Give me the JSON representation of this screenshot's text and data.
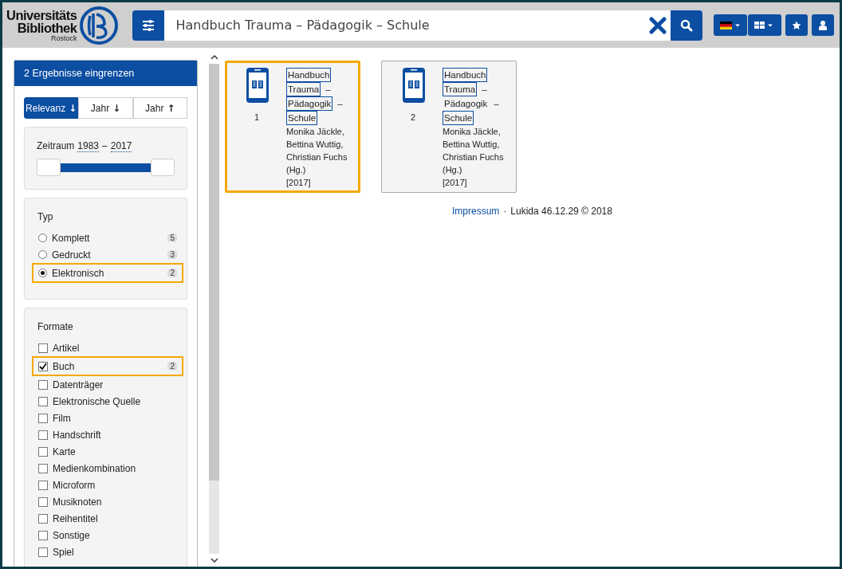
{
  "header": {
    "logo": {
      "line_1": "Universitäts",
      "line_2": "Bibliothek",
      "line_3": "Rostock"
    },
    "search": {
      "value": "Handbuch Trauma – Pädagogik – Schule"
    }
  },
  "sidebar": {
    "title": "2 Ergebnisse eingrenzen",
    "sort_buttons": [
      {
        "label": "Relevanz",
        "arrow": "↓",
        "selected": true
      },
      {
        "label": "Jahr",
        "arrow": "↓",
        "selected": false
      },
      {
        "label": "Jahr",
        "arrow": "↑",
        "selected": false
      }
    ],
    "period": {
      "label": "Zeitraum",
      "from": "1983",
      "separator": "–",
      "to": "2017",
      "thumbs": [
        {
          "level": 0
        },
        {
          "level": 1
        }
      ]
    },
    "type_filter": {
      "title": "Typ",
      "options": [
        {
          "label": "Komplett",
          "count": "5",
          "selected": false,
          "highlighted": false
        },
        {
          "label": "Gedruckt",
          "count": "3",
          "selected": false,
          "highlighted": false
        },
        {
          "label": "Elektronisch",
          "count": "2",
          "selected": true,
          "highlighted": true
        }
      ]
    },
    "format_filter": {
      "title": "Formate",
      "options": [
        {
          "label": "Artikel",
          "checked": false,
          "highlighted": false
        },
        {
          "label": "Buch",
          "count": "2",
          "checked": true,
          "highlighted": true
        },
        {
          "label": "Datenträger",
          "checked": false,
          "highlighted": false
        },
        {
          "label": "Elektronische Quelle",
          "checked": false,
          "highlighted": false
        },
        {
          "label": "Film",
          "checked": false,
          "highlighted": false
        },
        {
          "label": "Handschrift",
          "checked": false,
          "highlighted": false
        },
        {
          "label": "Karte",
          "checked": false,
          "highlighted": false
        },
        {
          "label": "Medienkombination",
          "checked": false,
          "highlighted": false
        },
        {
          "label": "Microform",
          "checked": false,
          "highlighted": false
        },
        {
          "label": "Musiknoten",
          "checked": false,
          "highlighted": false
        },
        {
          "label": "Reihentitel",
          "checked": false,
          "highlighted": false
        },
        {
          "label": "Sonstige",
          "checked": false,
          "highlighted": false
        },
        {
          "label": "Spiel",
          "checked": false,
          "highlighted": false
        }
      ]
    }
  },
  "results": [
    {
      "number": "1",
      "selected": true,
      "title_lines": [
        [
          {
            "text": "Handbuch",
            "highlighted": true
          }
        ],
        [
          {
            "text": "Trauma",
            "highlighted": true
          },
          {
            "text": "–",
            "highlighted": false
          }
        ],
        [
          {
            "text": "Pädagogik",
            "highlighted": true
          },
          {
            "text": "–",
            "highlighted": false
          }
        ],
        [
          {
            "text": "Schule",
            "highlighted": true
          }
        ]
      ],
      "authors": [
        "Monika Jäckle,",
        "Bettina Wuttig,",
        "Christian Fuchs",
        "(Hg.)"
      ],
      "year": "[2017]"
    },
    {
      "number": "2",
      "selected": false,
      "title_lines": [
        [
          {
            "text": "Handbuch",
            "highlighted": true
          }
        ],
        [
          {
            "text": "Trauma",
            "highlighted": true
          },
          {
            "text": "–",
            "highlighted": false
          }
        ],
        [
          {
            "text": "Pädagogik",
            "highlighted": false
          },
          {
            "text": "–",
            "highlighted": false
          }
        ],
        [
          {
            "text": "Schule",
            "highlighted": true
          }
        ]
      ],
      "authors": [
        "Monika Jäckle,",
        "Bettina Wuttig,",
        "Christian Fuchs",
        "(Hg.)"
      ],
      "year": "[2017]"
    }
  ],
  "footer": {
    "link": "Impressum",
    "separator": "·",
    "text": "Lukida 46.12.29 © 2018"
  }
}
